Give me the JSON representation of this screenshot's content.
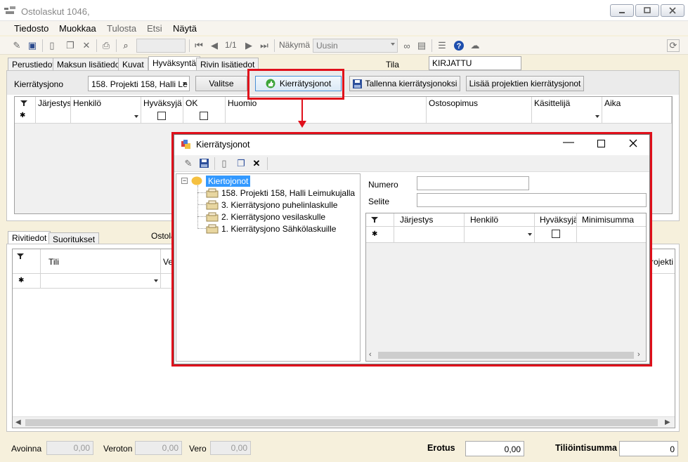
{
  "window": {
    "title": "Ostolaskut 1046,"
  },
  "menu": [
    "Tiedosto",
    "Muokkaa",
    "Tulosta",
    "Etsi",
    "Näytä"
  ],
  "toolbar": {
    "page_indicator": "1/1",
    "view_label": "Näkymä",
    "view_value": "Uusin"
  },
  "tabs": [
    "Perustiedot",
    "Maksun lisätiedot",
    "Kuvat",
    "Hyväksyntä",
    "Rivin lisätiedot"
  ],
  "status": {
    "label": "Tila",
    "value": "KIRJATTU"
  },
  "approval": {
    "queue_label": "Kierrätysjono",
    "queue_value": "158. Projekti 158, Halli Le",
    "select_btn": "Valitse",
    "queues_btn": "Kierrätysjonot",
    "save_btn": "Tallenna kierrätysjonoksi",
    "add_btn": "Lisää projektien kierrätysjonot",
    "columns": [
      "Järjestys",
      "Henkilö",
      "Hyväksyjä",
      "OK",
      "Huomio",
      "Ostosopimus",
      "Käsittelijä",
      "Aika"
    ]
  },
  "lower_tabs": [
    "Rivitiedot",
    "Suoritukset"
  ],
  "lower_label": "Ostola",
  "rows_grid": {
    "columns": [
      "Tili",
      "Ve",
      "rojekti"
    ]
  },
  "footer": {
    "open_label": "Avoinna",
    "open_value": "0,00",
    "net_label": "Veroton",
    "net_value": "0,00",
    "tax_label": "Vero",
    "tax_value": "0,00",
    "diff_label": "Erotus",
    "diff_value": "0,00",
    "sum_label": "Tiliöintisumma",
    "sum_value": "0"
  },
  "dialog": {
    "title": "Kierrätysjonot",
    "tree_root": "Kiertojonot",
    "tree_items": [
      "158. Projekti 158, Halli Leimukujalla",
      "3. Kierrätysjono puhelinlaskulle",
      "2. Kierrätysjono vesilaskulle",
      "1. Kierrätysjono Sähkölaskuille"
    ],
    "number_label": "Numero",
    "desc_label": "Selite",
    "columns": [
      "Järjestys",
      "Henkilö",
      "Hyväksyjä",
      "Minimisumma"
    ]
  },
  "colors": {
    "highlight": "#e0101b",
    "selection": "#3399ff",
    "bg": "#f6f0dc"
  }
}
